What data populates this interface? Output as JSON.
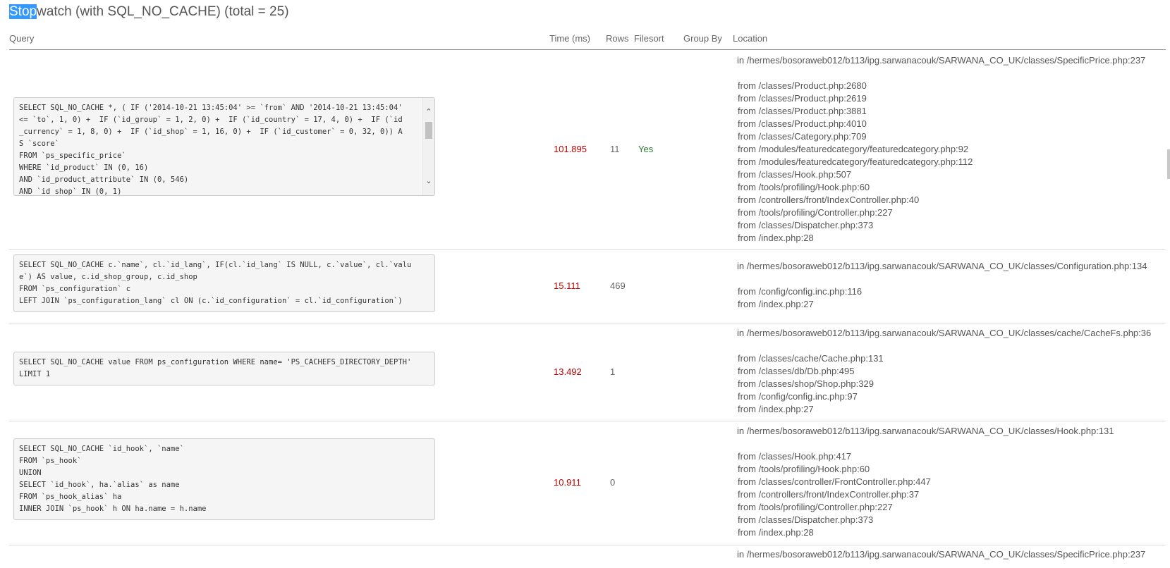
{
  "title": {
    "highlighted": "Stop",
    "rest": "watch (with SQL_NO_CACHE) (total = 25)"
  },
  "columns": {
    "query": "Query",
    "time": "Time (ms)",
    "rows": "Rows",
    "filesort": "Filesort",
    "group_by": "Group By",
    "location": "Location"
  },
  "entries": [
    {
      "query_lines": [
        "SELECT SQL_NO_CACHE *, ( IF ('2014-10-21 13:45:04' >= `from` AND '2014-10-21 13:45:04'",
        "<= `to`, 1, 0) +  IF (`id_group` = 1, 2, 0) +  IF (`id_country` = 17, 4, 0) +  IF (`id",
        "_currency` = 1, 8, 0) +  IF (`id_shop` = 1, 16, 0) +  IF (`id_customer` = 0, 32, 0)) A",
        "S `score`",
        "FROM `ps_specific_price`",
        "WHERE `id_product` IN (0, 16)",
        "AND `id_product_attribute` IN (0, 546)",
        "AND `id_shop` IN (0, 1)"
      ],
      "time": "101.895",
      "rows": "11",
      "filesort": "Yes",
      "group_by": "",
      "location_first": "in /hermes/bosoraweb012/b113/ipg.sarwanacouk/SARWANA_CO_UK/classes/SpecificPrice.php:237",
      "location_from": [
        "from /classes/Product.php:2680",
        "from /classes/Product.php:2619",
        "from /classes/Product.php:3881",
        "from /classes/Product.php:4010",
        "from /classes/Category.php:709",
        "from /modules/featuredcategory/featuredcategory.php:92",
        "from /modules/featuredcategory/featuredcategory.php:112",
        "from /classes/Hook.php:507",
        "from /tools/profiling/Hook.php:60",
        "from /controllers/front/IndexController.php:40",
        "from /tools/profiling/Controller.php:227",
        "from /classes/Dispatcher.php:373",
        "from /index.php:28"
      ]
    },
    {
      "query_lines": [
        "SELECT SQL_NO_CACHE c.`name`, cl.`id_lang`, IF(cl.`id_lang` IS NULL, c.`value`, cl.`valu",
        "e`) AS value, c.id_shop_group, c.id_shop",
        "FROM `ps_configuration` c",
        "LEFT JOIN `ps_configuration_lang` cl ON (c.`id_configuration` = cl.`id_configuration`)"
      ],
      "time": "15.111",
      "rows": "469",
      "filesort": "",
      "group_by": "",
      "location_first": "in /hermes/bosoraweb012/b113/ipg.sarwanacouk/SARWANA_CO_UK/classes/Configuration.php:134",
      "location_from": [
        "from /config/config.inc.php:116",
        "from /index.php:27"
      ]
    },
    {
      "query_lines": [
        "SELECT SQL_NO_CACHE value FROM ps_configuration WHERE name= 'PS_CACHEFS_DIRECTORY_DEPTH'",
        "LIMIT 1"
      ],
      "time": "13.492",
      "rows": "1",
      "filesort": "",
      "group_by": "",
      "location_first": "in /hermes/bosoraweb012/b113/ipg.sarwanacouk/SARWANA_CO_UK/classes/cache/CacheFs.php:36",
      "location_from": [
        "from /classes/cache/Cache.php:131",
        "from /classes/db/Db.php:495",
        "from /classes/shop/Shop.php:329",
        "from /config/config.inc.php:97",
        "from /index.php:27"
      ]
    },
    {
      "query_lines": [
        "SELECT SQL_NO_CACHE `id_hook`, `name`",
        "FROM `ps_hook`",
        "UNION",
        "SELECT `id_hook`, ha.`alias` as name",
        "FROM `ps_hook_alias` ha",
        "INNER JOIN `ps_hook` h ON ha.name = h.name"
      ],
      "time": "10.911",
      "rows": "0",
      "filesort": "",
      "group_by": "",
      "location_first": "in /hermes/bosoraweb012/b113/ipg.sarwanacouk/SARWANA_CO_UK/classes/Hook.php:131",
      "location_from": [
        "from /classes/Hook.php:417",
        "from /tools/profiling/Hook.php:60",
        "from /classes/controller/FrontController.php:447",
        "from /controllers/front/IndexController.php:37",
        "from /tools/profiling/Controller.php:227",
        "from /classes/Dispatcher.php:373",
        "from /index.php:28"
      ]
    },
    {
      "query_lines": [],
      "time": "",
      "rows": "",
      "filesort": "",
      "group_by": "",
      "location_first": "in /hermes/bosoraweb012/b113/ipg.sarwanacouk/SARWANA_CO_UK/classes/SpecificPrice.php:237",
      "location_from": []
    }
  ],
  "icons": {
    "scroll_up": "chevron-up-icon",
    "scroll_down": "chevron-down-icon"
  },
  "colors": {
    "time": "#c00000",
    "filesort_yes": "#2a7a2a",
    "selection": "#3399ff"
  }
}
